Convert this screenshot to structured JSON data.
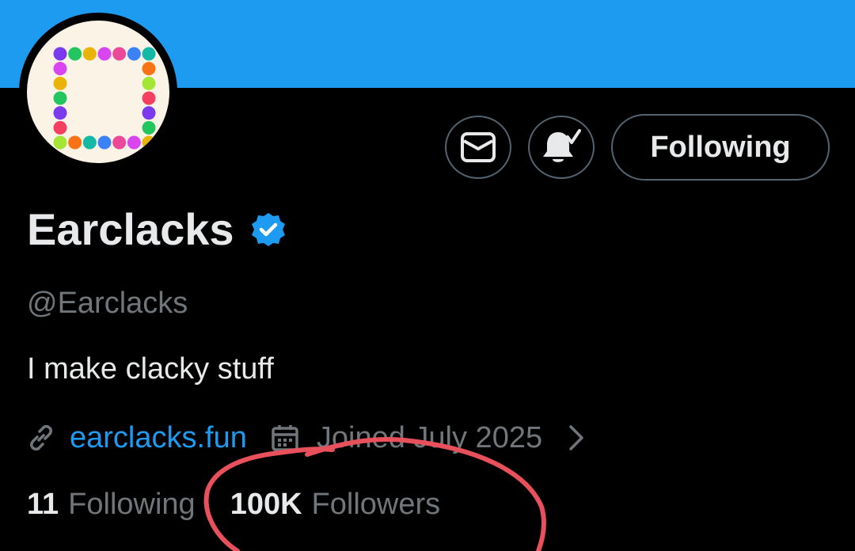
{
  "profile": {
    "display_name": "Earclacks",
    "handle": "@Earclacks",
    "bio": "I make clacky stuff",
    "website": "earclacks.fun",
    "joined": "Joined July 2025",
    "verified": true
  },
  "actions": {
    "message_icon": "envelope-icon",
    "notify_icon": "bell-check-icon",
    "following_label": "Following"
  },
  "stats": {
    "following_count": "11",
    "following_label": "Following",
    "followers_count": "100K",
    "followers_label": "Followers"
  },
  "colors": {
    "banner": "#1d9bf0",
    "accent": "#1d9bf0",
    "annotation": "#e8505b"
  }
}
